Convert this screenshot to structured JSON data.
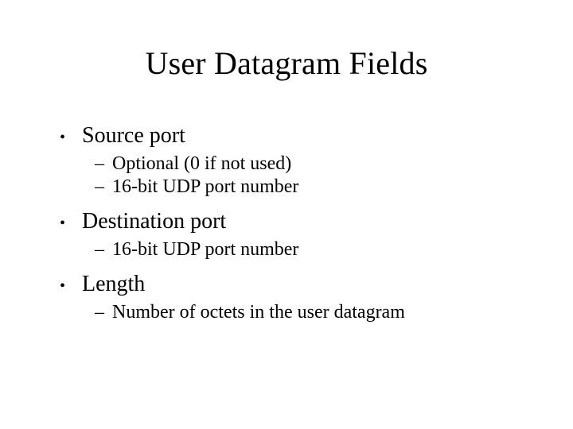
{
  "title": "User Datagram Fields",
  "items": [
    {
      "label": "Source port",
      "sub": [
        "Optional (0 if not used)",
        "16-bit UDP port number"
      ]
    },
    {
      "label": "Destination port",
      "sub": [
        "16-bit UDP port number"
      ]
    },
    {
      "label": "Length",
      "sub": [
        "Number of octets in the user datagram"
      ]
    }
  ]
}
